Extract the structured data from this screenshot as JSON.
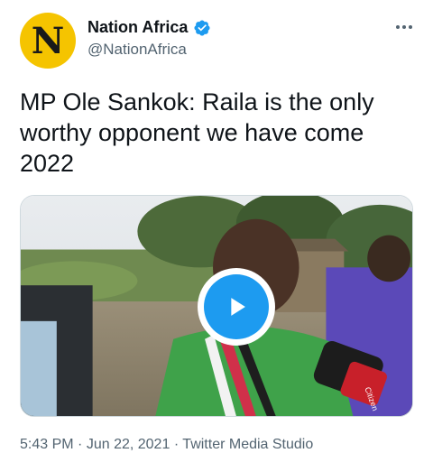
{
  "tweet": {
    "author_name": "Nation Africa",
    "handle": "@NationAfrica",
    "avatar_letter": "N",
    "text": "MP Ole Sankok: Raila is the only worthy opponent we have come 2022",
    "time": "5:43 PM",
    "separator": "·",
    "date": "Jun 22, 2021",
    "source": "Twitter Media Studio",
    "verified": true
  },
  "icons": {
    "verified": "verified-badge-icon",
    "more": "more-options-icon",
    "play": "play-icon"
  },
  "media": {
    "mic_label": "Citizen"
  },
  "colors": {
    "accent": "#1d9bf0",
    "avatar_bg": "#f5c400",
    "text_primary": "#0f1419",
    "text_secondary": "#536471"
  }
}
